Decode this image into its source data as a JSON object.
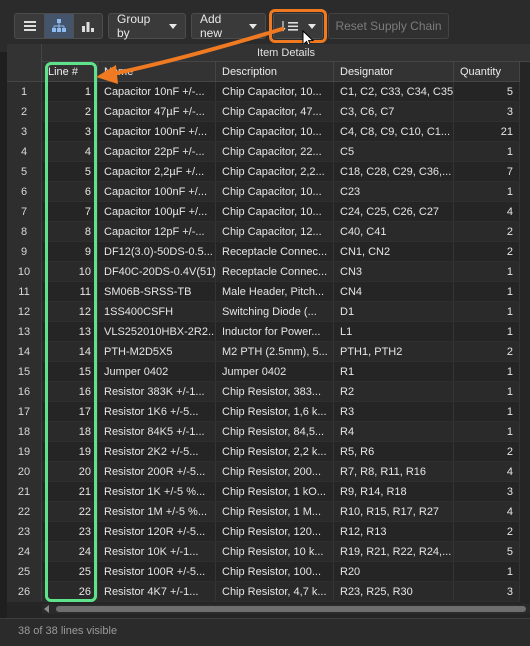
{
  "toolbar": {
    "view_buttons": [
      "list-view-icon",
      "tree-view-icon",
      "chart-view-icon"
    ],
    "group_by_label": "Group by",
    "add_new_label": "Add new",
    "sort_icon": "sort-lines-icon",
    "reset_label": "Reset Supply Chain"
  },
  "grid": {
    "group_header": "Item Details",
    "columns": [
      "Line #",
      "Name",
      "Description",
      "Designator",
      "Quantity"
    ],
    "rows": [
      {
        "n": "1",
        "line": "1",
        "name": "Capacitor 10nF +/-...",
        "desc": "Chip Capacitor, 10...",
        "des": "C1, C2, C33, C34, C35",
        "qty": "5"
      },
      {
        "n": "2",
        "line": "2",
        "name": "Capacitor 47µF +/-...",
        "desc": "Chip Capacitor, 47...",
        "des": "C3, C6, C7",
        "qty": "3"
      },
      {
        "n": "3",
        "line": "3",
        "name": "Capacitor 100nF +/...",
        "desc": "Chip Capacitor, 10...",
        "des": "C4, C8, C9, C10, C1...",
        "qty": "21"
      },
      {
        "n": "4",
        "line": "4",
        "name": "Capacitor 22pF +/-...",
        "desc": "Chip Capacitor, 22...",
        "des": "C5",
        "qty": "1"
      },
      {
        "n": "5",
        "line": "5",
        "name": "Capacitor 2,2µF +/...",
        "desc": "Chip Capacitor, 2,2...",
        "des": "C18, C28, C29, C36,...",
        "qty": "7"
      },
      {
        "n": "6",
        "line": "6",
        "name": "Capacitor 100nF +/...",
        "desc": "Chip Capacitor, 10...",
        "des": "C23",
        "qty": "1"
      },
      {
        "n": "7",
        "line": "7",
        "name": "Capacitor 100µF +/...",
        "desc": "Chip Capacitor, 10...",
        "des": "C24, C25, C26, C27",
        "qty": "4"
      },
      {
        "n": "8",
        "line": "8",
        "name": "Capacitor 12pF +/-...",
        "desc": "Chip Capacitor, 12...",
        "des": "C40, C41",
        "qty": "2"
      },
      {
        "n": "9",
        "line": "9",
        "name": "DF12(3.0)-50DS-0.5...",
        "desc": "Receptacle Connec...",
        "des": "CN1, CN2",
        "qty": "2"
      },
      {
        "n": "10",
        "line": "10",
        "name": "DF40C-20DS-0.4V(51)",
        "desc": "Receptacle Connec...",
        "des": "CN3",
        "qty": "1"
      },
      {
        "n": "11",
        "line": "11",
        "name": "SM06B-SRSS-TB",
        "desc": "Male Header, Pitch...",
        "des": "CN4",
        "qty": "1"
      },
      {
        "n": "12",
        "line": "12",
        "name": "1SS400CSFH",
        "desc": "Switching Diode (...",
        "des": "D1",
        "qty": "1"
      },
      {
        "n": "13",
        "line": "13",
        "name": "VLS252010HBX-2R2...",
        "desc": "Inductor for Power...",
        "des": "L1",
        "qty": "1"
      },
      {
        "n": "14",
        "line": "14",
        "name": "PTH-M2D5X5",
        "desc": "M2 PTH (2.5mm), 5...",
        "des": "PTH1, PTH2",
        "qty": "2"
      },
      {
        "n": "15",
        "line": "15",
        "name": "Jumper 0402",
        "desc": "Jumper 0402",
        "des": "R1",
        "qty": "1"
      },
      {
        "n": "16",
        "line": "16",
        "name": "Resistor 383K +/-1...",
        "desc": "Chip Resistor, 383...",
        "des": "R2",
        "qty": "1"
      },
      {
        "n": "17",
        "line": "17",
        "name": "Resistor 1K6 +/-5...",
        "desc": "Chip Resistor, 1,6 k...",
        "des": "R3",
        "qty": "1"
      },
      {
        "n": "18",
        "line": "18",
        "name": "Resistor 84K5 +/-1...",
        "desc": "Chip Resistor, 84,5...",
        "des": "R4",
        "qty": "1"
      },
      {
        "n": "19",
        "line": "19",
        "name": "Resistor 2K2 +/-5...",
        "desc": "Chip Resistor, 2,2 k...",
        "des": "R5, R6",
        "qty": "2"
      },
      {
        "n": "20",
        "line": "20",
        "name": "Resistor 200R +/-5...",
        "desc": "Chip Resistor, 200...",
        "des": "R7, R8, R11, R16",
        "qty": "4"
      },
      {
        "n": "21",
        "line": "21",
        "name": "Resistor 1K +/-5 %...",
        "desc": "Chip Resistor, 1 kO...",
        "des": "R9, R14, R18",
        "qty": "3"
      },
      {
        "n": "22",
        "line": "22",
        "name": "Resistor 1M +/-5 %...",
        "desc": "Chip Resistor, 1 M...",
        "des": "R10, R15, R17, R27",
        "qty": "4"
      },
      {
        "n": "23",
        "line": "23",
        "name": "Resistor 120R +/-5...",
        "desc": "Chip Resistor, 120...",
        "des": "R12, R13",
        "qty": "2"
      },
      {
        "n": "24",
        "line": "24",
        "name": "Resistor 10K +/-1...",
        "desc": "Chip Resistor, 10 k...",
        "des": "R19, R21, R22, R24,...",
        "qty": "5"
      },
      {
        "n": "25",
        "line": "25",
        "name": "Resistor 100R +/-5...",
        "desc": "Chip Resistor, 100...",
        "des": "R20",
        "qty": "1"
      },
      {
        "n": "26",
        "line": "26",
        "name": "Resistor 4K7 +/-1...",
        "desc": "Chip Resistor, 4,7 k...",
        "des": "R23, R25, R30",
        "qty": "3"
      }
    ]
  },
  "status": {
    "lines_visible": "38 of 38 lines visible"
  },
  "colors": {
    "highlight_orange": "#f07a22",
    "highlight_green": "#5fe38a",
    "background": "#1f1f1f"
  }
}
